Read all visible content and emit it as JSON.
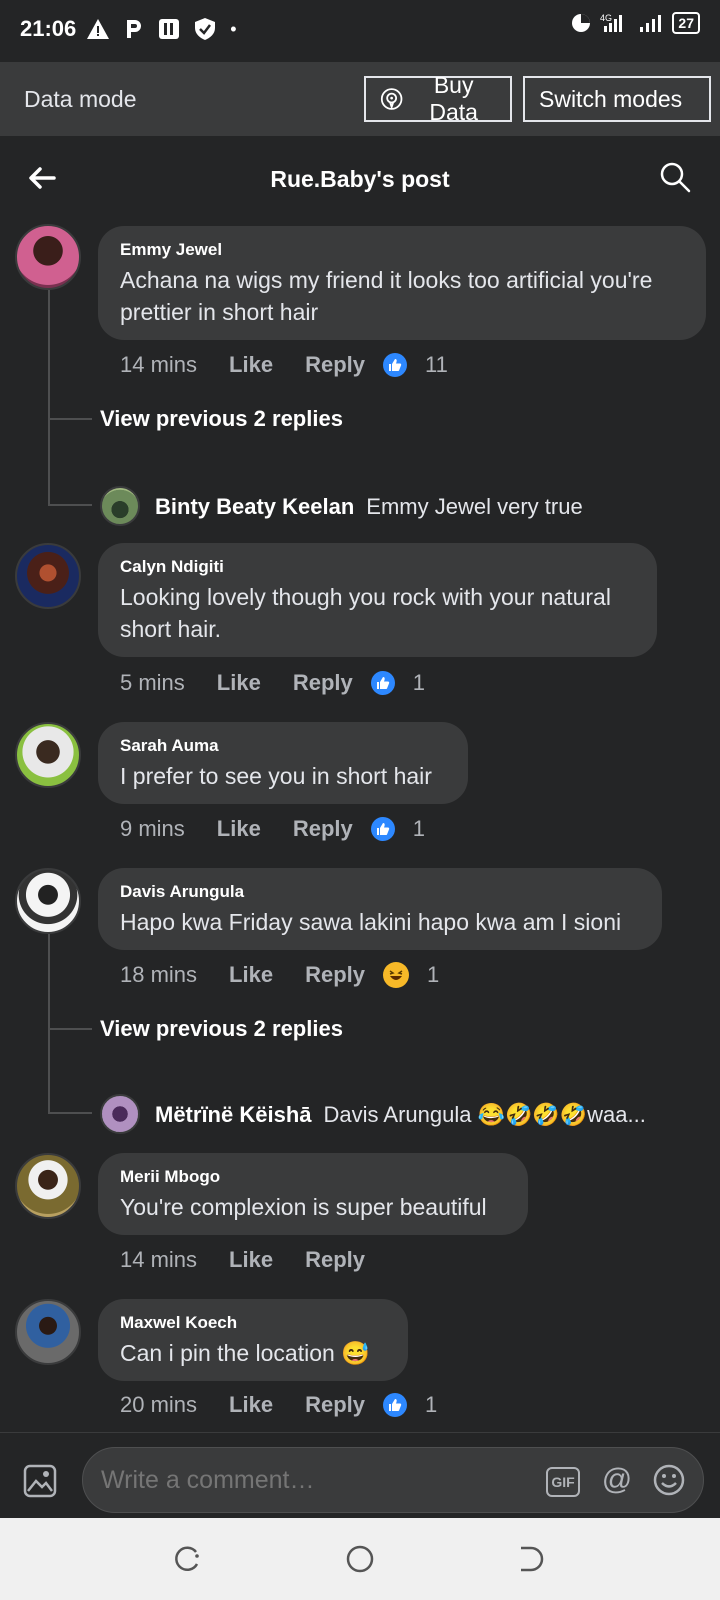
{
  "status_bar": {
    "time": "21:06",
    "battery": "27"
  },
  "data_mode": {
    "title": "Data mode",
    "buy_label": "Buy Data",
    "switch_label": "Switch modes"
  },
  "header": {
    "title": "Rue.Baby's post"
  },
  "comments": [
    {
      "author": "Emmy Jewel",
      "text": "Achana na wigs my friend it looks too artificial you're prettier in short hair",
      "time": "14 mins",
      "like": "Like",
      "reply": "Reply",
      "reaction": "like",
      "count": "11"
    },
    {
      "author": "Calyn Ndigiti",
      "text": "Looking lovely though you rock with your natural short hair.",
      "time": "5 mins",
      "like": "Like",
      "reply": "Reply",
      "reaction": "like",
      "count": "1"
    },
    {
      "author": "Sarah Auma",
      "text": "I prefer to see you in short hair",
      "time": "9 mins",
      "like": "Like",
      "reply": "Reply",
      "reaction": "like",
      "count": "1"
    },
    {
      "author": "Davis Arungula",
      "text": "Hapo kwa Friday sawa lakini hapo kwa am I sioni",
      "time": "18 mins",
      "like": "Like",
      "reply": "Reply",
      "reaction": "haha",
      "count": "1"
    },
    {
      "author": "Merii Mbogo",
      "text": "You're complexion is super beautiful",
      "time": "14 mins",
      "like": "Like",
      "reply": "Reply"
    },
    {
      "author": "Maxwel Koech",
      "text": "Can i pin the location 😅",
      "time": "20 mins",
      "like": "Like",
      "reply": "Reply",
      "reaction": "like",
      "count": "1"
    }
  ],
  "replies": [
    {
      "view_previous": "View previous 2 replies",
      "author": "Binty Beaty Keelan",
      "text": "Emmy Jewel very true"
    },
    {
      "view_previous": "View previous 2 replies",
      "author": "Mëtrïnë Këishā",
      "text": "Davis Arungula 😂🤣🤣🤣waa..."
    }
  ],
  "composer": {
    "placeholder": "Write a comment…",
    "gif": "GIF"
  },
  "colors": {
    "background": "#242526",
    "bubble": "#3a3b3c",
    "accent": "#2d88ff"
  }
}
